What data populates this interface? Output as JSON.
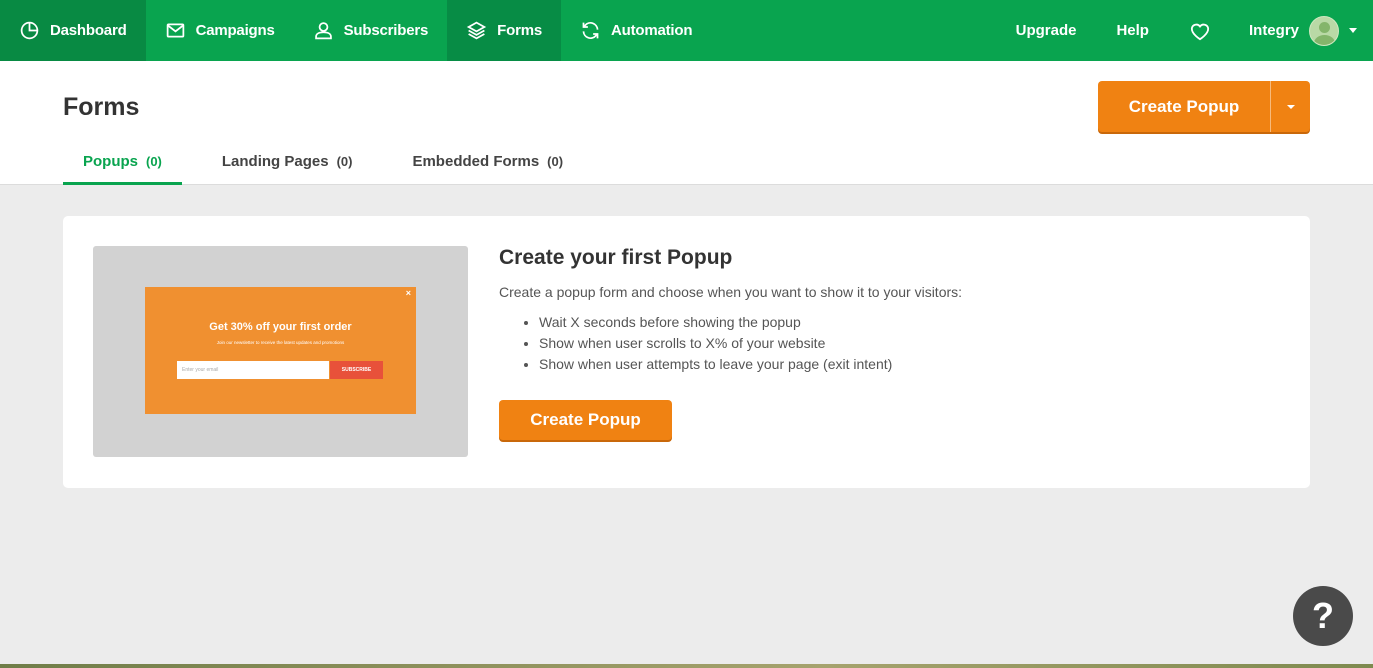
{
  "nav": {
    "items": [
      {
        "label": "Dashboard",
        "icon": "clock-pie-icon"
      },
      {
        "label": "Campaigns",
        "icon": "envelope-icon"
      },
      {
        "label": "Subscribers",
        "icon": "user-icon"
      },
      {
        "label": "Forms",
        "icon": "layers-icon"
      },
      {
        "label": "Automation",
        "icon": "refresh-icon"
      }
    ],
    "upgrade": "Upgrade",
    "help": "Help",
    "user_name": "Integry"
  },
  "page": {
    "title": "Forms",
    "create_button": "Create Popup"
  },
  "tabs": [
    {
      "label": "Popups",
      "count": "(0)"
    },
    {
      "label": "Landing Pages",
      "count": "(0)"
    },
    {
      "label": "Embedded Forms",
      "count": "(0)"
    }
  ],
  "card": {
    "preview": {
      "close": "×",
      "title": "Get 30% off your first order",
      "subtitle": "Join our newsletter to receive the latest updates and promotions",
      "input_placeholder": "Enter your email",
      "button": "SUBSCRIBE"
    },
    "heading": "Create your first Popup",
    "description": "Create a popup form and choose when you want to show it to your visitors:",
    "bullets": [
      "Wait X seconds before showing the popup",
      "Show when user scrolls to X% of your website",
      "Show when user attempts to leave your page (exit intent)"
    ],
    "button": "Create Popup"
  },
  "help_button": "?",
  "colors": {
    "brand_green": "#09a44f",
    "accent_orange": "#f08212"
  }
}
